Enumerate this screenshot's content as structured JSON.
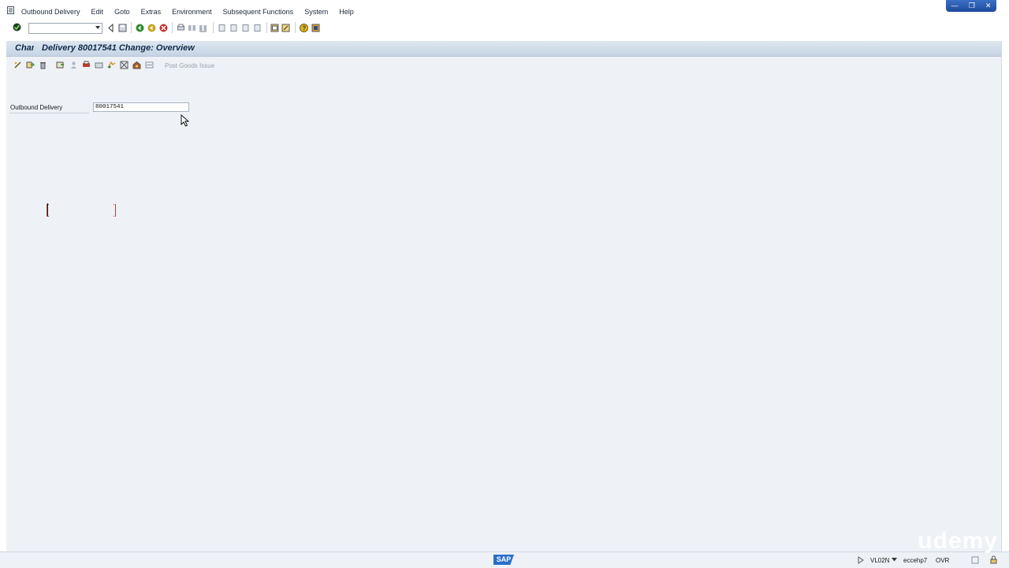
{
  "menubar": {
    "items": [
      "Outbound Delivery",
      "Edit",
      "Goto",
      "Extras",
      "Environment",
      "Subsequent Functions",
      "System",
      "Help"
    ]
  },
  "command_field": {
    "value": ""
  },
  "header": {
    "title_truncated": "Change",
    "title": "Delivery 80017541 Change: Overview"
  },
  "app_toolbar": {
    "post_goods_issue_label": "Post Goods Issue"
  },
  "form": {
    "delivery_label": "Outbound Delivery",
    "delivery_value": "80017541"
  },
  "statusbar": {
    "logo": "SAP",
    "transaction": "VL02N",
    "server": "eccehp7",
    "mode": "OVR"
  },
  "watermark": "udemy",
  "colors": {
    "background": "#eef1f6",
    "title_bar": "#c6d4e4",
    "sap_logo": "#2a6fc8"
  }
}
